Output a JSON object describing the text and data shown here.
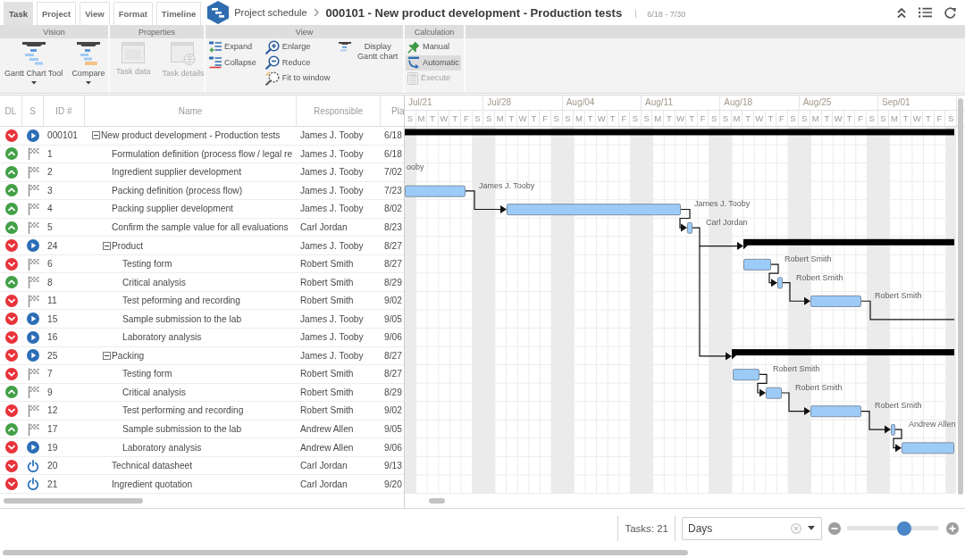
{
  "tabs": [
    {
      "label": "Task",
      "selected": true
    },
    {
      "label": "Project",
      "selected": false
    },
    {
      "label": "View",
      "selected": false
    },
    {
      "label": "Format",
      "selected": false
    },
    {
      "label": "Timeline",
      "selected": false
    }
  ],
  "header": {
    "breadcrumb": "Project schedule",
    "title": "000101 - New product development - Production tests",
    "date_range": "6/18 - 7/30"
  },
  "ribbon": [
    {
      "title": "Vision",
      "kind": "large",
      "columns": [
        [
          {
            "label": "Gantt Chart Tool",
            "dropdown": true,
            "disabled": false
          }
        ],
        [
          {
            "label": "Compare",
            "dropdown": true,
            "disabled": false
          }
        ]
      ]
    },
    {
      "title": "Properties",
      "kind": "large",
      "columns": [
        [
          {
            "label": "Task data",
            "disabled": true
          }
        ],
        [
          {
            "label": "Task details",
            "disabled": true
          }
        ]
      ]
    },
    {
      "title": "View",
      "kind": "small",
      "columns": [
        [
          {
            "label": "Expand",
            "disabled": false
          },
          {
            "label": "Collapse",
            "disabled": false
          }
        ],
        [
          {
            "label": "Enlarge",
            "disabled": false
          },
          {
            "label": "Reduce",
            "disabled": false
          },
          {
            "label": "Fit to window",
            "disabled": false
          }
        ],
        [
          {
            "label": "Display Gantt chart",
            "disabled": false
          }
        ]
      ]
    },
    {
      "title": "Calculation",
      "kind": "small",
      "columns": [
        [
          {
            "label": "Manual",
            "selected": false,
            "disabled": false
          },
          {
            "label": "Automatic",
            "selected": true,
            "disabled": false
          },
          {
            "label": "Execute",
            "selected": false,
            "disabled": true
          }
        ]
      ]
    }
  ],
  "table": {
    "columns": [
      "DL",
      "S",
      "ID #",
      "Name",
      "Responsible",
      "Pla"
    ],
    "rows": [
      {
        "dl_late": true,
        "kind": "play",
        "id": "000101",
        "name": "New product development - Production tests",
        "responsible": "James J. Tooby",
        "column_6": "6/18",
        "expanded": true,
        "children": [
          {
            "dl_late": false,
            "kind": "flag",
            "id": "1",
            "name": "Formulation definition (process flow / legal re",
            "responsible": "James J. Tooby",
            "column_6": "6/18"
          },
          {
            "dl_late": false,
            "kind": "flag",
            "id": "2",
            "name": "Ingredient supplier development",
            "responsible": "James J. Tooby",
            "column_6": "7/02"
          },
          {
            "dl_late": false,
            "kind": "flag",
            "id": "3",
            "name": "Packing definition (process flow)",
            "responsible": "James J. Tooby",
            "column_6": "7/23"
          },
          {
            "dl_late": false,
            "kind": "flag",
            "id": "4",
            "name": "Packing supplier development",
            "responsible": "James J. Tooby",
            "column_6": "8/02"
          },
          {
            "dl_late": false,
            "kind": "flag",
            "id": "5",
            "name": "Confirm the sample value for all evaluations",
            "responsible": "Carl Jordan",
            "column_6": "8/23"
          },
          {
            "dl_late": true,
            "kind": "play",
            "id": "24",
            "name": "Product",
            "responsible": "James J. Tooby",
            "column_6": "8/27",
            "expanded": true,
            "children": [
              {
                "dl_late": true,
                "kind": "flag",
                "id": "6",
                "name": "Testing form",
                "responsible": "Robert Smith",
                "column_6": "8/27"
              },
              {
                "dl_late": false,
                "kind": "flag",
                "id": "8",
                "name": "Critical analysis",
                "responsible": "Robert Smith",
                "column_6": "8/29"
              },
              {
                "dl_late": true,
                "kind": "flag",
                "id": "11",
                "name": "Test peforming and recording",
                "responsible": "Robert Smith",
                "column_6": "9/02"
              },
              {
                "dl_late": true,
                "kind": "play",
                "id": "15",
                "name": "Sample submission to the lab",
                "responsible": "James J. Tooby",
                "column_6": "9/05"
              },
              {
                "dl_late": true,
                "kind": "play",
                "id": "16",
                "name": "Laboratory analysis",
                "responsible": "James J. Tooby",
                "column_6": "9/06"
              }
            ]
          },
          {
            "dl_late": true,
            "kind": "play",
            "id": "25",
            "name": "Packing",
            "responsible": "James J. Tooby",
            "column_6": "8/27",
            "expanded": true,
            "children": [
              {
                "dl_late": true,
                "kind": "flag",
                "id": "7",
                "name": "Testing form",
                "responsible": "Robert Smith",
                "column_6": "8/27"
              },
              {
                "dl_late": false,
                "kind": "flag",
                "id": "9",
                "name": "Critical analysis",
                "responsible": "Robert Smith",
                "column_6": "8/29"
              },
              {
                "dl_late": true,
                "kind": "flag",
                "id": "12",
                "name": "Test performing and recording",
                "responsible": "Robert Smith",
                "column_6": "9/02"
              },
              {
                "dl_late": false,
                "kind": "flag",
                "id": "17",
                "name": "Sample submission to the lab",
                "responsible": "Andrew Allen",
                "column_6": "9/05"
              },
              {
                "dl_late": true,
                "kind": "play",
                "id": "19",
                "name": "Laboratory analysis",
                "responsible": "Andrew Allen",
                "column_6": "9/06"
              }
            ]
          },
          {
            "dl_late": true,
            "kind": "power",
            "id": "20",
            "name": "Technical datasheet",
            "responsible": "Carl Jordan",
            "column_6": "9/13"
          },
          {
            "dl_late": true,
            "kind": "power",
            "id": "21",
            "name": "Ingredient quotation",
            "responsible": "Carl Jordan",
            "column_6": "9/20"
          }
        ]
      }
    ]
  },
  "gantt": {
    "weeks": [
      {
        "label": "Jul/21",
        "days": [
          "S",
          "M",
          "T",
          "W",
          "T",
          "F",
          "S"
        ]
      },
      {
        "label": "Jul/28",
        "days": [
          "S",
          "M",
          "T",
          "W",
          "T",
          "F",
          "S"
        ]
      },
      {
        "label": "Aug/04",
        "days": [
          "S",
          "M",
          "T",
          "W",
          "T",
          "F",
          "S"
        ]
      },
      {
        "label": "Aug/11",
        "days": [
          "S",
          "M",
          "T",
          "W",
          "T",
          "F",
          "S"
        ]
      },
      {
        "label": "Aug/18",
        "days": [
          "S",
          "M",
          "T",
          "W",
          "T",
          "F",
          "S"
        ]
      },
      {
        "label": "Aug/25",
        "days": [
          "S",
          "M",
          "T",
          "W",
          "T",
          "F",
          "S"
        ]
      },
      {
        "label": "Sep/01",
        "days": [
          "S",
          "M",
          "T",
          "W",
          "T",
          "F",
          "S"
        ]
      }
    ],
    "bars": [
      {
        "kind": "summary"
      },
      {
        "kind": "label",
        "label": "ooby"
      },
      {
        "kind": "task",
        "label": "James J. Tooby"
      },
      {
        "kind": "task",
        "label": "James J. Tooby"
      },
      {
        "kind": "task",
        "label": "Carl Jordan"
      },
      {
        "kind": "summary"
      },
      {
        "kind": "task",
        "label": "Robert Smith"
      },
      {
        "kind": "task",
        "label": "Robert Smith"
      },
      {
        "kind": "task",
        "label": "Robert Smith"
      },
      {
        "kind": "summary"
      },
      {
        "kind": "task",
        "label": "Robert Smith"
      },
      {
        "kind": "task",
        "label": "Robert Smith"
      },
      {
        "kind": "task",
        "label": "Robert Smith"
      },
      {
        "kind": "task",
        "label": "Andrew Allen"
      },
      {
        "kind": "task"
      }
    ]
  },
  "status_bar": {
    "task_count": "Tasks: 21",
    "scale": {
      "value": "Days"
    },
    "zoom": {
      "level": 0.63
    }
  }
}
